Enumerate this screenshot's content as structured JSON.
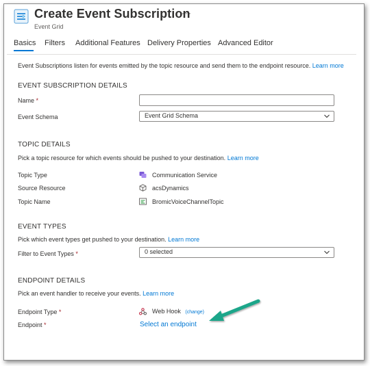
{
  "header": {
    "title": "Create Event Subscription",
    "subtitle": "Event Grid",
    "more": "···",
    "icon": "event-grid-icon"
  },
  "tabs": [
    {
      "label": "Basics",
      "active": true
    },
    {
      "label": "Filters"
    },
    {
      "label": "Additional Features"
    },
    {
      "label": "Delivery Properties"
    },
    {
      "label": "Advanced Editor"
    }
  ],
  "intro": {
    "text": "Event Subscriptions listen for events emitted by the topic resource and send them to the endpoint resource.",
    "link": "Learn more"
  },
  "details": {
    "heading": "EVENT SUBSCRIPTION DETAILS",
    "name_label": "Name",
    "name_value": "",
    "required_mark": "*",
    "schema_label": "Event Schema",
    "schema_value": "Event Grid Schema"
  },
  "topic": {
    "heading": "TOPIC DETAILS",
    "desc": "Pick a topic resource for which events should be pushed to your destination.",
    "link": "Learn more",
    "type_label": "Topic Type",
    "type_value": "Communication Service",
    "type_icon": "communication-service-icon",
    "source_label": "Source Resource",
    "source_value": "acsDynamics",
    "source_icon": "cube-icon",
    "name_label": "Topic Name",
    "name_value": "BromicVoiceChannelTopic",
    "name_icon": "topic-icon"
  },
  "event_types": {
    "heading": "EVENT TYPES",
    "desc": "Pick which event types get pushed to your destination.",
    "link": "Learn more",
    "filter_label": "Filter to Event Types",
    "filter_value": "0 selected"
  },
  "endpoint": {
    "heading": "ENDPOINT DETAILS",
    "desc": "Pick an event handler to receive your events.",
    "link": "Learn more",
    "type_label": "Endpoint Type",
    "type_value": "Web Hook",
    "type_icon": "webhook-icon",
    "change": "(change)",
    "endpoint_label": "Endpoint",
    "endpoint_link": "Select an endpoint"
  },
  "colors": {
    "accent": "#0078d4",
    "required": "#a4262c",
    "annotation_arrow": "#1ea68a"
  }
}
